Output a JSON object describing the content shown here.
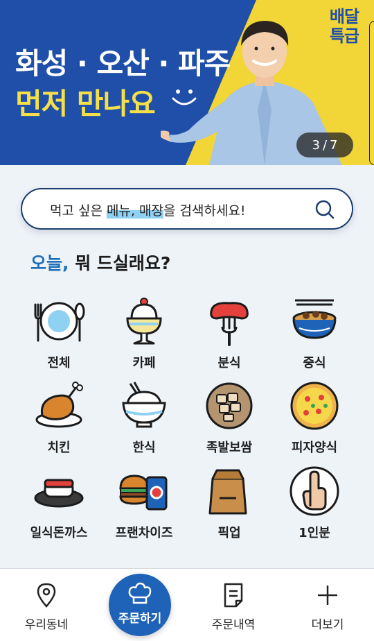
{
  "banner": {
    "title": "화성 · 오산 · 파주",
    "subtitle": "먼저 만나요",
    "logo_line1": "배달",
    "logo_line2": "특급",
    "counter_current": "3",
    "counter_sep": "/",
    "counter_total": "7",
    "colors": {
      "blue": "#1f4fa8",
      "yellow": "#f2d536"
    }
  },
  "search": {
    "prefix": "먹고 싶은 ",
    "highlight": "메뉴, 매장",
    "suffix": "을 검색하세요!"
  },
  "heading": {
    "accent": "오늘,",
    "rest": " 뭐 드실래요?"
  },
  "categories": [
    {
      "label": "전체",
      "icon": "plate-utensils-icon"
    },
    {
      "label": "카페",
      "icon": "parfait-icon"
    },
    {
      "label": "분식",
      "icon": "sausage-fork-icon"
    },
    {
      "label": "중식",
      "icon": "noodle-bowl-icon"
    },
    {
      "label": "치킨",
      "icon": "chicken-icon"
    },
    {
      "label": "한식",
      "icon": "rice-bowl-icon"
    },
    {
      "label": "족발보쌈",
      "icon": "jokbal-plate-icon"
    },
    {
      "label": "피자양식",
      "icon": "pizza-icon"
    },
    {
      "label": "일식돈까스",
      "icon": "sushi-icon"
    },
    {
      "label": "프랜차이즈",
      "icon": "burger-drink-icon"
    },
    {
      "label": "픽업",
      "icon": "paper-bag-icon"
    },
    {
      "label": "1인분",
      "icon": "one-finger-icon"
    }
  ],
  "nav": {
    "neighborhood": "우리동네",
    "order": "주문하기",
    "history": "주문내역",
    "more": "더보기"
  }
}
